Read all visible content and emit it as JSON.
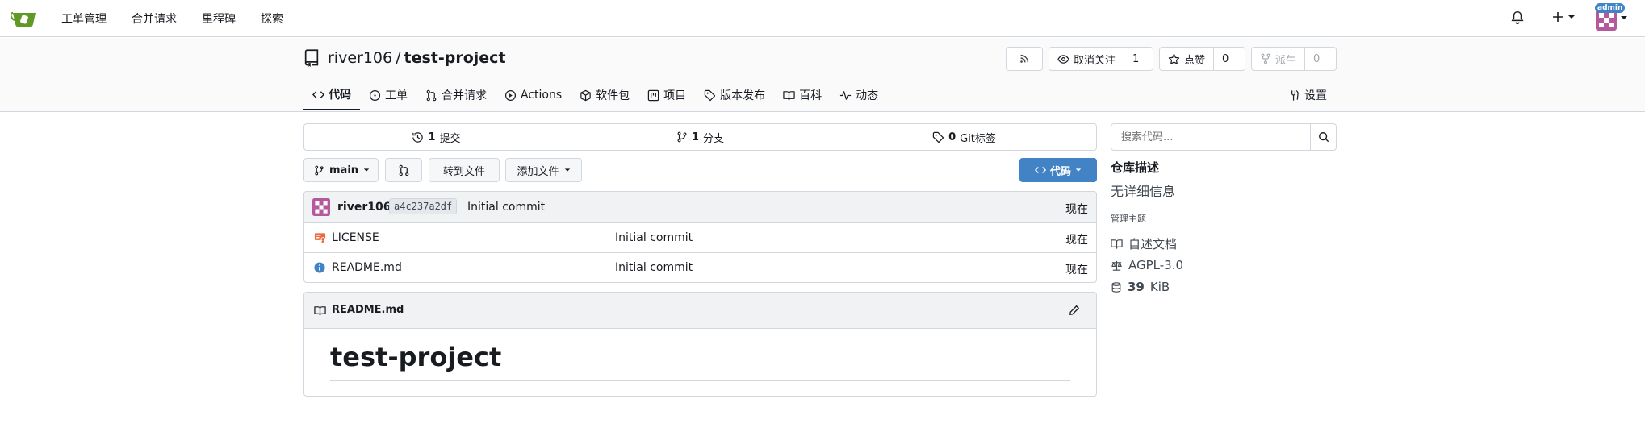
{
  "nav": {
    "items": [
      "工单管理",
      "合并请求",
      "里程碑",
      "探索"
    ],
    "admin_badge": "admin"
  },
  "repo": {
    "owner": "river106",
    "separator": "/",
    "name": "test-project",
    "watch_label": "取消关注",
    "watch_count": "1",
    "star_label": "点赞",
    "star_count": "0",
    "fork_label": "派生",
    "fork_count": "0"
  },
  "tabs": [
    {
      "label": "代码",
      "icon": "code-icon"
    },
    {
      "label": "工单",
      "icon": "issue-icon"
    },
    {
      "label": "合并请求",
      "icon": "pull-request-icon"
    },
    {
      "label": "Actions",
      "icon": "play-icon"
    },
    {
      "label": "软件包",
      "icon": "package-icon"
    },
    {
      "label": "项目",
      "icon": "project-icon"
    },
    {
      "label": "版本发布",
      "icon": "tag-icon"
    },
    {
      "label": "百科",
      "icon": "book-icon"
    },
    {
      "label": "动态",
      "icon": "pulse-icon"
    }
  ],
  "settings_label": "设置",
  "stats": {
    "commits_count": "1",
    "commits_label": "提交",
    "branches_count": "1",
    "branches_label": "分支",
    "tags_count": "0",
    "tags_label": "Git标签"
  },
  "toolbar": {
    "branch": "main",
    "goto_file": "转到文件",
    "add_file": "添加文件",
    "code_button": "代码"
  },
  "latest_commit": {
    "author": "river106",
    "sha": "a4c237a2df",
    "message": "Initial commit",
    "time": "现在"
  },
  "files": [
    {
      "name": "LICENSE",
      "commit": "Initial commit",
      "time": "现在",
      "icon": "license-icon"
    },
    {
      "name": "README.md",
      "commit": "Initial commit",
      "time": "现在",
      "icon": "info-icon"
    }
  ],
  "readme": {
    "filename": "README.md",
    "heading": "test-project"
  },
  "sidebar": {
    "search_placeholder": "搜索代码...",
    "title": "仓库描述",
    "description": "无详细信息",
    "topics_label": "管理主题",
    "readme_link": "自述文档",
    "license": "AGPL-3.0",
    "size_value": "39",
    "size_unit": "KiB"
  },
  "colors": {
    "accent": "#4183c4",
    "logo_green": "#609926",
    "border": "#d0d7de"
  }
}
